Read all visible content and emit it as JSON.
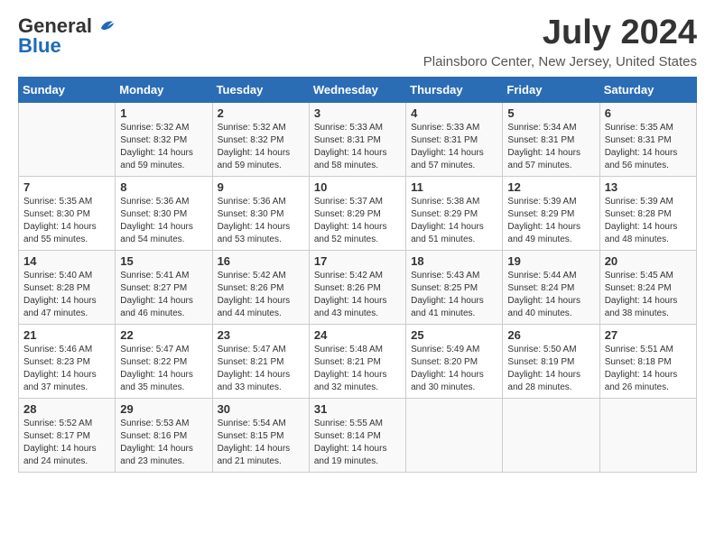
{
  "logo": {
    "general": "General",
    "blue": "Blue",
    "tagline": ""
  },
  "title": "July 2024",
  "location": "Plainsboro Center, New Jersey, United States",
  "weekdays": [
    "Sunday",
    "Monday",
    "Tuesday",
    "Wednesday",
    "Thursday",
    "Friday",
    "Saturday"
  ],
  "weeks": [
    [
      {
        "day": "",
        "info": ""
      },
      {
        "day": "1",
        "info": "Sunrise: 5:32 AM\nSunset: 8:32 PM\nDaylight: 14 hours\nand 59 minutes."
      },
      {
        "day": "2",
        "info": "Sunrise: 5:32 AM\nSunset: 8:32 PM\nDaylight: 14 hours\nand 59 minutes."
      },
      {
        "day": "3",
        "info": "Sunrise: 5:33 AM\nSunset: 8:31 PM\nDaylight: 14 hours\nand 58 minutes."
      },
      {
        "day": "4",
        "info": "Sunrise: 5:33 AM\nSunset: 8:31 PM\nDaylight: 14 hours\nand 57 minutes."
      },
      {
        "day": "5",
        "info": "Sunrise: 5:34 AM\nSunset: 8:31 PM\nDaylight: 14 hours\nand 57 minutes."
      },
      {
        "day": "6",
        "info": "Sunrise: 5:35 AM\nSunset: 8:31 PM\nDaylight: 14 hours\nand 56 minutes."
      }
    ],
    [
      {
        "day": "7",
        "info": "Sunrise: 5:35 AM\nSunset: 8:30 PM\nDaylight: 14 hours\nand 55 minutes."
      },
      {
        "day": "8",
        "info": "Sunrise: 5:36 AM\nSunset: 8:30 PM\nDaylight: 14 hours\nand 54 minutes."
      },
      {
        "day": "9",
        "info": "Sunrise: 5:36 AM\nSunset: 8:30 PM\nDaylight: 14 hours\nand 53 minutes."
      },
      {
        "day": "10",
        "info": "Sunrise: 5:37 AM\nSunset: 8:29 PM\nDaylight: 14 hours\nand 52 minutes."
      },
      {
        "day": "11",
        "info": "Sunrise: 5:38 AM\nSunset: 8:29 PM\nDaylight: 14 hours\nand 51 minutes."
      },
      {
        "day": "12",
        "info": "Sunrise: 5:39 AM\nSunset: 8:29 PM\nDaylight: 14 hours\nand 49 minutes."
      },
      {
        "day": "13",
        "info": "Sunrise: 5:39 AM\nSunset: 8:28 PM\nDaylight: 14 hours\nand 48 minutes."
      }
    ],
    [
      {
        "day": "14",
        "info": "Sunrise: 5:40 AM\nSunset: 8:28 PM\nDaylight: 14 hours\nand 47 minutes."
      },
      {
        "day": "15",
        "info": "Sunrise: 5:41 AM\nSunset: 8:27 PM\nDaylight: 14 hours\nand 46 minutes."
      },
      {
        "day": "16",
        "info": "Sunrise: 5:42 AM\nSunset: 8:26 PM\nDaylight: 14 hours\nand 44 minutes."
      },
      {
        "day": "17",
        "info": "Sunrise: 5:42 AM\nSunset: 8:26 PM\nDaylight: 14 hours\nand 43 minutes."
      },
      {
        "day": "18",
        "info": "Sunrise: 5:43 AM\nSunset: 8:25 PM\nDaylight: 14 hours\nand 41 minutes."
      },
      {
        "day": "19",
        "info": "Sunrise: 5:44 AM\nSunset: 8:24 PM\nDaylight: 14 hours\nand 40 minutes."
      },
      {
        "day": "20",
        "info": "Sunrise: 5:45 AM\nSunset: 8:24 PM\nDaylight: 14 hours\nand 38 minutes."
      }
    ],
    [
      {
        "day": "21",
        "info": "Sunrise: 5:46 AM\nSunset: 8:23 PM\nDaylight: 14 hours\nand 37 minutes."
      },
      {
        "day": "22",
        "info": "Sunrise: 5:47 AM\nSunset: 8:22 PM\nDaylight: 14 hours\nand 35 minutes."
      },
      {
        "day": "23",
        "info": "Sunrise: 5:47 AM\nSunset: 8:21 PM\nDaylight: 14 hours\nand 33 minutes."
      },
      {
        "day": "24",
        "info": "Sunrise: 5:48 AM\nSunset: 8:21 PM\nDaylight: 14 hours\nand 32 minutes."
      },
      {
        "day": "25",
        "info": "Sunrise: 5:49 AM\nSunset: 8:20 PM\nDaylight: 14 hours\nand 30 minutes."
      },
      {
        "day": "26",
        "info": "Sunrise: 5:50 AM\nSunset: 8:19 PM\nDaylight: 14 hours\nand 28 minutes."
      },
      {
        "day": "27",
        "info": "Sunrise: 5:51 AM\nSunset: 8:18 PM\nDaylight: 14 hours\nand 26 minutes."
      }
    ],
    [
      {
        "day": "28",
        "info": "Sunrise: 5:52 AM\nSunset: 8:17 PM\nDaylight: 14 hours\nand 24 minutes."
      },
      {
        "day": "29",
        "info": "Sunrise: 5:53 AM\nSunset: 8:16 PM\nDaylight: 14 hours\nand 23 minutes."
      },
      {
        "day": "30",
        "info": "Sunrise: 5:54 AM\nSunset: 8:15 PM\nDaylight: 14 hours\nand 21 minutes."
      },
      {
        "day": "31",
        "info": "Sunrise: 5:55 AM\nSunset: 8:14 PM\nDaylight: 14 hours\nand 19 minutes."
      },
      {
        "day": "",
        "info": ""
      },
      {
        "day": "",
        "info": ""
      },
      {
        "day": "",
        "info": ""
      }
    ]
  ]
}
